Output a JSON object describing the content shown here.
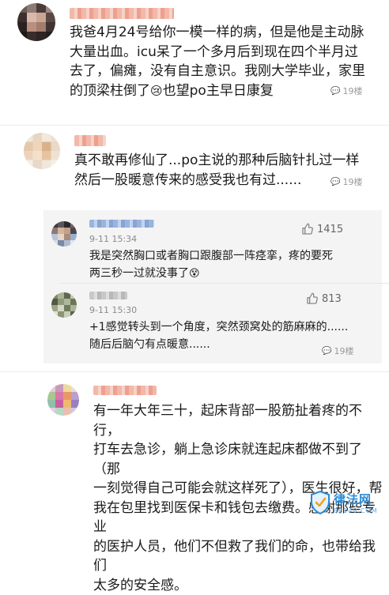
{
  "posts": [
    {
      "text_lines": [
        "我爸4月24号给你一模一样的病，但是他是主动脉",
        "大量出血。icu呆了一个多月后到现在四个半月过",
        "去了，偏瘫，没有自主意识。我刚大学毕业，家里",
        "的顶梁柱倒了"
      ],
      "text_tail": "也望po主早日康复",
      "emoji": "😢",
      "floor": "19楼"
    },
    {
      "text_lines": [
        "真不敢再修仙了...po主说的那种后脑针扎过一样",
        "然后一股暖意传来的感受我也有过......"
      ],
      "floor": "19楼"
    },
    {
      "text_lines": [
        "有一年大年三十，起床背部一股筋扯着疼的不行，",
        "打车去急诊，躺上急诊床就连起床都做不到了（那",
        "一刻觉得自己可能会就这样死了），医生很好，帮",
        "我在包里找到医保卡和钱包去缴费。感谢那些专业",
        "的医护人员，他们不但救了我们的命，也带给我们",
        "太多的安全感。"
      ]
    }
  ],
  "replies": [
    {
      "time": "9-11 15:34",
      "likes": "1415",
      "text_lines": [
        "我是突然胸口或者胸口跟腹部一阵痉挛，疼的要死",
        "两三秒一过就没事了"
      ],
      "emoji": "😵"
    },
    {
      "time": "9-11 15:30",
      "likes": "813",
      "text_lines": [
        "+1感觉转头到一个角度，突然颈窝处的筋麻麻的......",
        "随后后脑勺有点暖意......"
      ],
      "floor": "19楼"
    }
  ],
  "watermark": {
    "name": "律法网",
    "url": "88148.COM"
  },
  "icons": {
    "floor": "comment-icon",
    "like": "thumbs-up-icon",
    "watermark": "shield-icon"
  }
}
